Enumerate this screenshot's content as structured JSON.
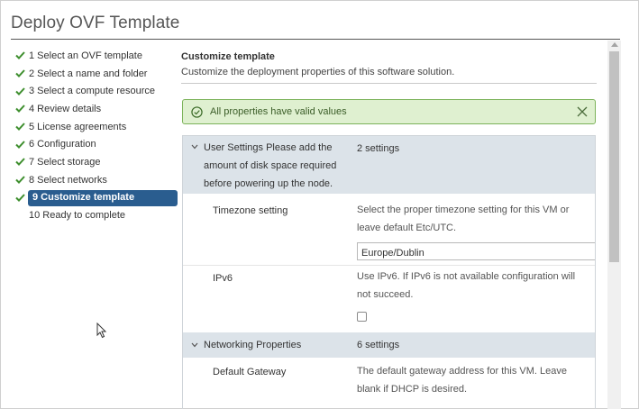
{
  "window": {
    "title": "Deploy OVF Template"
  },
  "steps": [
    {
      "label": "1 Select an OVF template",
      "done": true
    },
    {
      "label": "2 Select a name and folder",
      "done": true
    },
    {
      "label": "3 Select a compute resource",
      "done": true
    },
    {
      "label": "4 Review details",
      "done": true
    },
    {
      "label": "5 License agreements",
      "done": true
    },
    {
      "label": "6 Configuration",
      "done": true
    },
    {
      "label": "7 Select storage",
      "done": true
    },
    {
      "label": "8 Select networks",
      "done": true
    },
    {
      "label": "9 Customize template",
      "done": true,
      "active": true
    },
    {
      "label": "10 Ready to complete",
      "done": false
    }
  ],
  "content": {
    "title": "Customize template",
    "subtitle": "Customize the deployment properties of this software solution."
  },
  "alert": {
    "message": "All properties have valid values",
    "status": "success"
  },
  "groups": [
    {
      "name_lines": [
        "User Settings Please add the",
        "amount of disk space required",
        "before powering up the node."
      ],
      "count": "2 settings"
    },
    {
      "name_lines": [
        "Networking Properties"
      ],
      "count": "6 settings"
    }
  ],
  "settings": {
    "timezone": {
      "label": "Timezone setting",
      "desc_lines": [
        "Select the proper timezone setting for this VM or",
        "leave default Etc/UTC."
      ],
      "value": "Europe/Dublin"
    },
    "ipv6": {
      "label": "IPv6",
      "desc_lines": [
        "Use IPv6. If IPv6 is not available configuration will",
        "not succeed."
      ],
      "checked": false
    },
    "gateway": {
      "label": "Default Gateway",
      "desc_lines": [
        "The default gateway address for this VM. Leave",
        "blank if DHCP is desired."
      ]
    }
  },
  "colors": {
    "active_step_bg": "#2a5d8f",
    "check_green": "#3f8f2f",
    "alert_bg": "#dff0d0",
    "alert_border": "#7cb35a",
    "group_header_bg": "#dce3e9"
  },
  "icons": {
    "step_done": "checkmark-icon",
    "alert": "check-circle-icon",
    "alert_close": "close-icon",
    "group_toggle": "chevron-down-icon",
    "pointer": "mouse-cursor-icon"
  }
}
